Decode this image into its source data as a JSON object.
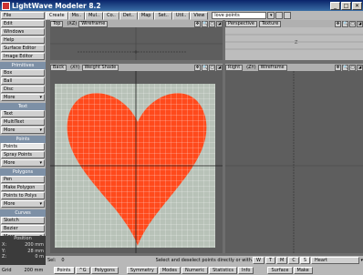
{
  "window": {
    "title": "LightWave Modeler 8.2",
    "minimize": "_",
    "maximize": "□",
    "close": "✕"
  },
  "toolbox": {
    "top_buttons": [
      "File",
      "Edit",
      "Windows",
      "Help",
      "Surface Editor",
      "Image Editor"
    ],
    "sections": [
      {
        "title": "Primitives",
        "items": [
          "Box",
          "Ball",
          "Disc",
          "More"
        ]
      },
      {
        "title": "Text",
        "items": [
          "Text",
          "MultiText",
          "More"
        ]
      },
      {
        "title": "Points",
        "items": [
          "Points",
          "Spray Points",
          "More"
        ]
      },
      {
        "title": "Polygons",
        "items": [
          "Pen",
          "Make Polygon",
          "Points to Polys",
          "More"
        ]
      },
      {
        "title": "Curves",
        "items": [
          "Sketch",
          "Bezier",
          "More"
        ]
      }
    ],
    "position": {
      "title": "Position",
      "x": "200 mm",
      "y": "28 mm",
      "z": "0 m"
    }
  },
  "tabs": [
    "Create",
    "Mo..",
    "Mul..",
    "Co..",
    "Det..",
    "Map",
    "Set..",
    "Util..",
    "View"
  ],
  "active_tab": "Create",
  "layer_field": "love points",
  "viewports": {
    "top": {
      "name": "Top",
      "axis": "(XZ)",
      "mode": "Wireframe"
    },
    "perspective": {
      "name": "Perspective",
      "mode": "Texture",
      "axis_marker": "Z"
    },
    "back": {
      "name": "Back",
      "axis": "(XY)",
      "mode": "Weight Shade"
    },
    "right": {
      "name": "Right",
      "axis": "(ZY)",
      "mode": "Wireframe"
    }
  },
  "viewport_controls": [
    "✥",
    "🔍",
    "▢",
    "◪"
  ],
  "status": {
    "sel_label": "Sel:",
    "sel_value": "0",
    "message": "Select and deselect points directly or with...",
    "wtmcs": [
      "W",
      "T",
      "M",
      "C",
      "S"
    ],
    "surface": "Heart"
  },
  "bottom_bar": {
    "grid_label": "Grid",
    "grid_value": "200 mm",
    "points": "Points",
    "points_key": "^G",
    "polygons": "Polygons",
    "symmetry": "Symmetry",
    "modes": "Modes",
    "numeric": "Numeric",
    "statistics": "Statistics",
    "info": "Info",
    "surface": "Surface",
    "make": "Make"
  },
  "colors": {
    "heart": "#ff4a1c",
    "grid_bg": "#b8c2b8",
    "viewport_bg": "#5e5e5e"
  }
}
